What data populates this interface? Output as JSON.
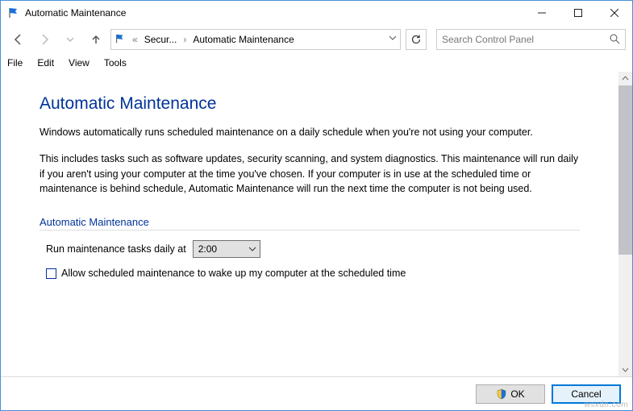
{
  "window": {
    "title": "Automatic Maintenance"
  },
  "breadcrumb": {
    "seg1": "Secur...",
    "seg2": "Automatic Maintenance"
  },
  "search": {
    "placeholder": "Search Control Panel"
  },
  "menu": {
    "file": "File",
    "edit": "Edit",
    "view": "View",
    "tools": "Tools"
  },
  "page": {
    "title": "Automatic Maintenance",
    "p1": "Windows automatically runs scheduled maintenance on a daily schedule when you're not using your computer.",
    "p2": "This includes tasks such as software updates, security scanning, and system diagnostics. This maintenance will run daily if you aren't using your computer at the time you've chosen. If your computer is in use at the scheduled time or maintenance is behind schedule, Automatic Maintenance will run the next time the computer is not being used.",
    "section_head": "Automatic Maintenance",
    "field_label": "Run maintenance tasks daily at",
    "time_value": "2:00",
    "checkbox_label": "Allow scheduled maintenance to wake up my computer at the scheduled time",
    "checkbox_checked": false
  },
  "footer": {
    "ok": "OK",
    "cancel": "Cancel"
  },
  "watermark": "wsxdn.com"
}
